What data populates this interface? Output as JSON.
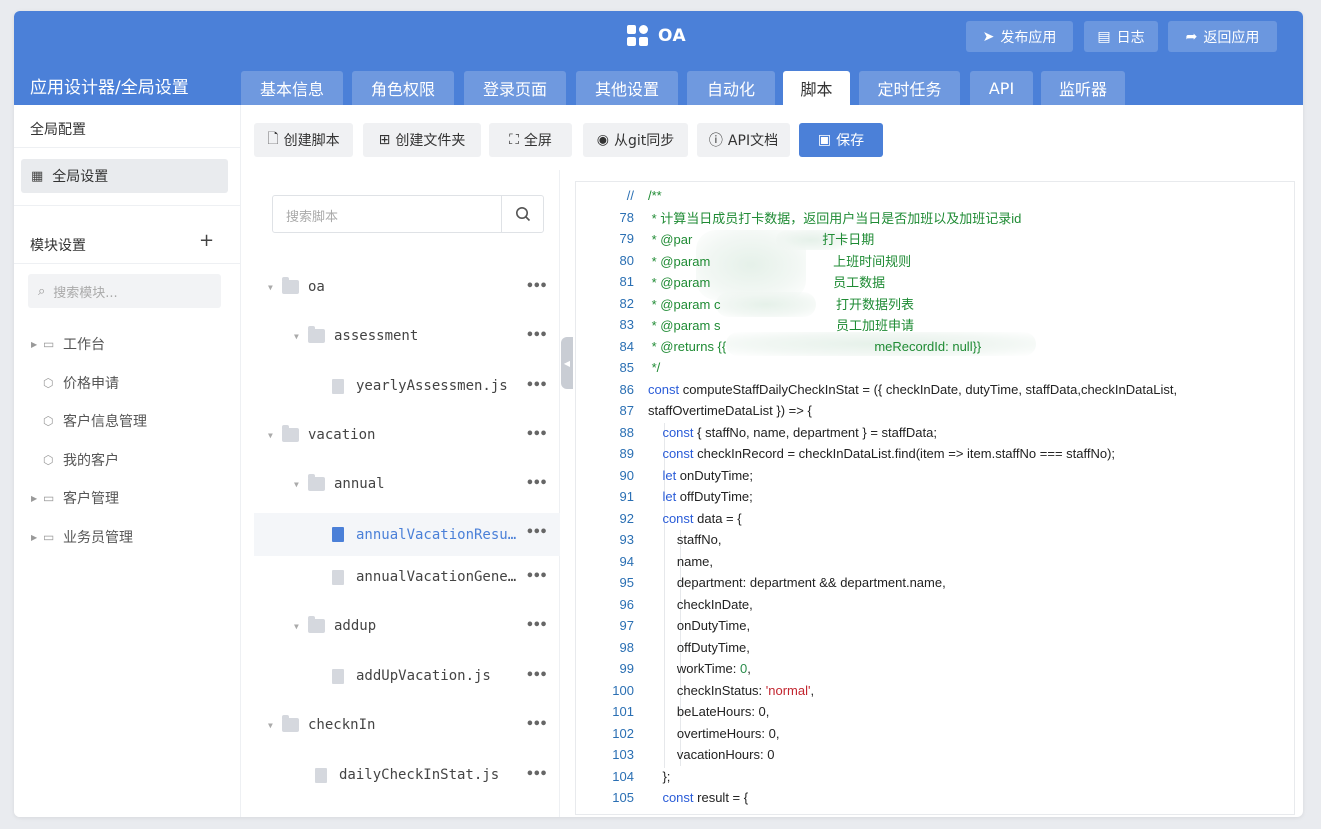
{
  "app": {
    "title": "OA",
    "buttons": {
      "publish": "发布应用",
      "log": "日志",
      "back": "返回应用"
    }
  },
  "nav": {
    "breadcrumb": "应用设计器/全局设置",
    "tabs": [
      "基本信息",
      "角色权限",
      "登录页面",
      "其他设置",
      "自动化",
      "脚本",
      "定时任务",
      "API",
      "监听器"
    ],
    "active_tab": "脚本"
  },
  "sidebar": {
    "global_config": "全局配置",
    "global_settings": "全局设置",
    "module_settings": "模块设置",
    "search_placeholder": "搜索模块...",
    "items": [
      {
        "label": "工作台",
        "type": "folder"
      },
      {
        "label": "价格申请",
        "type": "module"
      },
      {
        "label": "客户信息管理",
        "type": "module"
      },
      {
        "label": "我的客户",
        "type": "module"
      },
      {
        "label": "客户管理",
        "type": "folder"
      },
      {
        "label": "业务员管理",
        "type": "folder"
      }
    ]
  },
  "toolbar": {
    "create_script": "创建脚本",
    "create_folder": "创建文件夹",
    "fullscreen": "全屏",
    "git_sync": "从git同步",
    "api_docs": "API文档",
    "save": "保存"
  },
  "tree": {
    "search_placeholder": "搜索脚本",
    "nodes": [
      {
        "label": "oa",
        "type": "folder",
        "depth": 0
      },
      {
        "label": "assessment",
        "type": "folder",
        "depth": 1
      },
      {
        "label": "yearlyAssessmen.js",
        "type": "file",
        "depth": 2
      },
      {
        "label": "vacation",
        "type": "folder",
        "depth": 0
      },
      {
        "label": "annual",
        "type": "folder",
        "depth": 1
      },
      {
        "label": "annualVacationResu…",
        "type": "file",
        "depth": 2,
        "selected": true
      },
      {
        "label": "annualVacationGene…",
        "type": "file",
        "depth": 2
      },
      {
        "label": "addup",
        "type": "folder",
        "depth": 1
      },
      {
        "label": "addUpVacation.js",
        "type": "file",
        "depth": 2
      },
      {
        "label": "checknIn",
        "type": "folder",
        "depth": 0
      },
      {
        "label": "dailyCheckInStat.js",
        "type": "file",
        "depth": 1
      }
    ]
  },
  "editor": {
    "lines": [
      {
        "n": "//",
        "text": "/**",
        "cls": "c-cmt"
      },
      {
        "n": "78",
        "text": " * 计算当日成员打卡数据，返回用户当日是否加班以及加班记录id",
        "cls": "c-cmt"
      },
      {
        "n": "79",
        "text": " * @par                                    打卡日期",
        "cls": "c-cmt"
      },
      {
        "n": "80",
        "text": " * @param                                  上班时间规则",
        "cls": "c-cmt"
      },
      {
        "n": "81",
        "text": " * @param                                  员工数据",
        "cls": "c-cmt"
      },
      {
        "n": "82",
        "text": " * @param c                                打开数据列表",
        "cls": "c-cmt"
      },
      {
        "n": "83",
        "text": " * @param s                                员工加班申请",
        "cls": "c-cmt"
      },
      {
        "n": "84",
        "text": " * @returns {{                                         meRecordId: null}}",
        "cls": "c-cmt"
      },
      {
        "n": "85",
        "text": " */",
        "cls": "c-cmt"
      },
      {
        "n": "86",
        "kw": "const",
        "text": " computeStaffDailyCheckInStat = ({ checkInDate, dutyTime, staffData,checkInDataList,",
        "cls": ""
      },
      {
        "n": "87",
        "text": "staffOvertimeDataList }) => {",
        "cls": ""
      },
      {
        "n": "88",
        "kw": "    const",
        "text": " { staffNo, name, department } = staffData;",
        "cls": ""
      },
      {
        "n": "89",
        "kw": "    const",
        "text": " checkInRecord = checkInDataList.find(item => item.staffNo === staffNo);",
        "cls": ""
      },
      {
        "n": "90",
        "kw": "    let",
        "text": " onDutyTime;",
        "cls": ""
      },
      {
        "n": "91",
        "kw": "    let",
        "text": " offDutyTime;",
        "cls": ""
      },
      {
        "n": "92",
        "kw": "    const",
        "text": " data = {",
        "cls": ""
      },
      {
        "n": "93",
        "text": "        staffNo,",
        "cls": ""
      },
      {
        "n": "94",
        "text": "        name,",
        "cls": ""
      },
      {
        "n": "95",
        "text": "        department: department && department.name,",
        "cls": ""
      },
      {
        "n": "96",
        "text": "        checkInDate,",
        "cls": ""
      },
      {
        "n": "97",
        "text": "        onDutyTime,",
        "cls": ""
      },
      {
        "n": "98",
        "text": "        offDutyTime,",
        "cls": ""
      },
      {
        "n": "99",
        "text": "        workTime: ",
        "num": "0",
        "tail": ",",
        "cls": ""
      },
      {
        "n": "100",
        "text": "        checkInStatus: ",
        "str": "'normal'",
        "tail": ",",
        "cls": ""
      },
      {
        "n": "101",
        "text": "        beLateHours: 0,",
        "cls": ""
      },
      {
        "n": "102",
        "text": "        overtimeHours: 0,",
        "cls": ""
      },
      {
        "n": "103",
        "text": "        vacationHours: 0",
        "cls": ""
      },
      {
        "n": "104",
        "text": "    };",
        "cls": ""
      },
      {
        "n": "105",
        "kw": "    const",
        "text": " result = {",
        "cls": ""
      }
    ]
  }
}
